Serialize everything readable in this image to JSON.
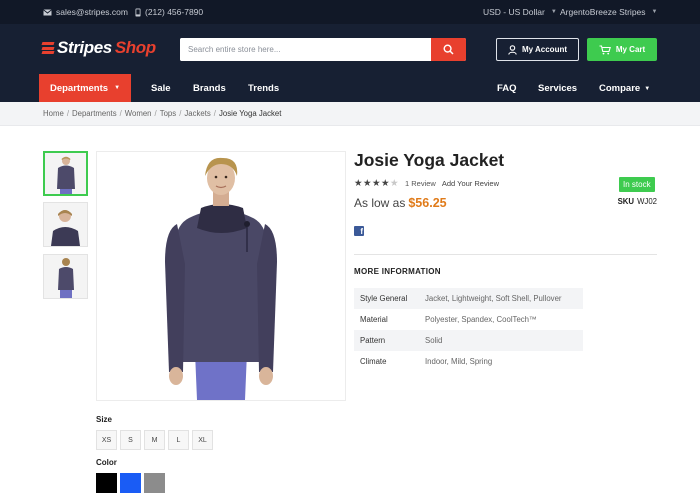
{
  "topbar": {
    "email": "sales@stripes.com",
    "phone": "(212) 456-7890",
    "currency": "USD - US Dollar",
    "store": "ArgentoBreeze Stripes"
  },
  "header": {
    "logo_part1": "Stripes",
    "logo_part2": "Shop",
    "search_placeholder": "Search entire store here...",
    "account_label": "My Account",
    "cart_label": "My Cart"
  },
  "nav": {
    "departments": "Departments",
    "left_links": [
      "Sale",
      "Brands",
      "Trends"
    ],
    "right_links": [
      "FAQ",
      "Services",
      "Compare"
    ]
  },
  "breadcrumb": [
    "Home",
    "Departments",
    "Women",
    "Tops",
    "Jackets",
    "Josie Yoga Jacket"
  ],
  "product": {
    "title": "Josie Yoga Jacket",
    "rating_stars": 4,
    "rating_max": 5,
    "review_count_text": "1  Review",
    "add_review": "Add Your Review",
    "stock": "In stock",
    "price_prefix": "As low as",
    "price": "$56.25",
    "sku_label": "SKU",
    "sku": "WJ02",
    "more_info_heading": "MORE INFORMATION",
    "specs": [
      {
        "label": "Style General",
        "value": "Jacket, Lightweight, Soft Shell, Pullover"
      },
      {
        "label": "Material",
        "value": "Polyester, Spandex, CoolTech™"
      },
      {
        "label": "Pattern",
        "value": "Solid"
      },
      {
        "label": "Climate",
        "value": "Indoor, Mild, Spring"
      }
    ],
    "size_label": "Size",
    "sizes": [
      "XS",
      "S",
      "M",
      "L",
      "XL"
    ],
    "color_label": "Color",
    "colors": [
      "#000000",
      "#1a5cf5",
      "#8c8c8c"
    ]
  },
  "theme": {
    "accent": "#e8402e",
    "green": "#3ecb4f",
    "navy": "#172033",
    "price": "#e07b1a"
  }
}
